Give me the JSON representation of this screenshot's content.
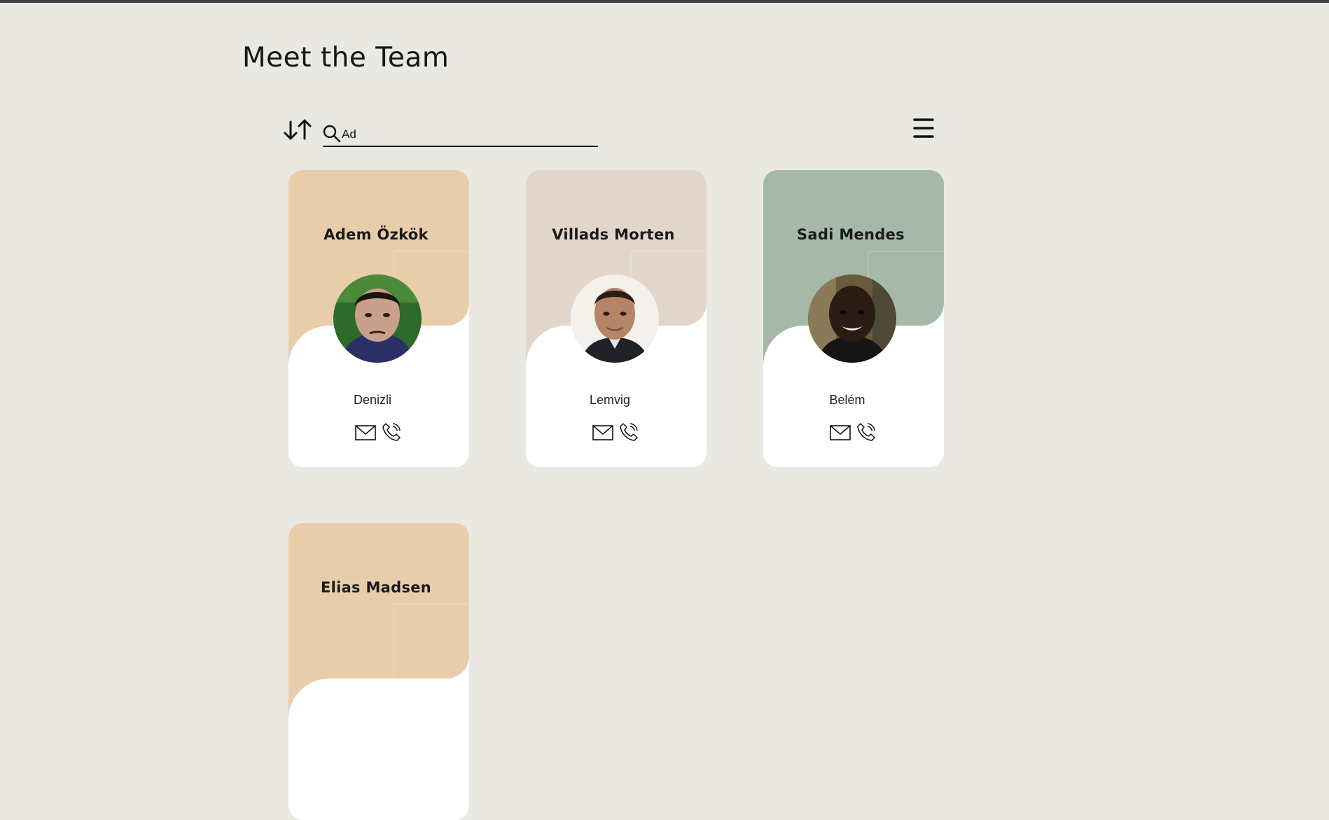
{
  "header": {
    "title": "Meet the Team"
  },
  "toolbar": {
    "sort_icon": "sort-arrows-icon",
    "search_icon": "magnifier-icon",
    "search_value": "Ad",
    "menu_icon": "hamburger-icon"
  },
  "cards": [
    {
      "name": "Adem Özkök",
      "city": "Denizli",
      "color": "#e8cdab"
    },
    {
      "name": "Villads Morten",
      "city": "Lemvig",
      "color": "#e2d6cb"
    },
    {
      "name": "Sadi Mendes",
      "city": "Belém",
      "color": "#a6b8a8"
    },
    {
      "name": "Elias Madsen",
      "color": "#e8cdab"
    }
  ],
  "colors": {
    "background": "#e9e8e3",
    "card": "#ffffff",
    "text": "#161616"
  }
}
